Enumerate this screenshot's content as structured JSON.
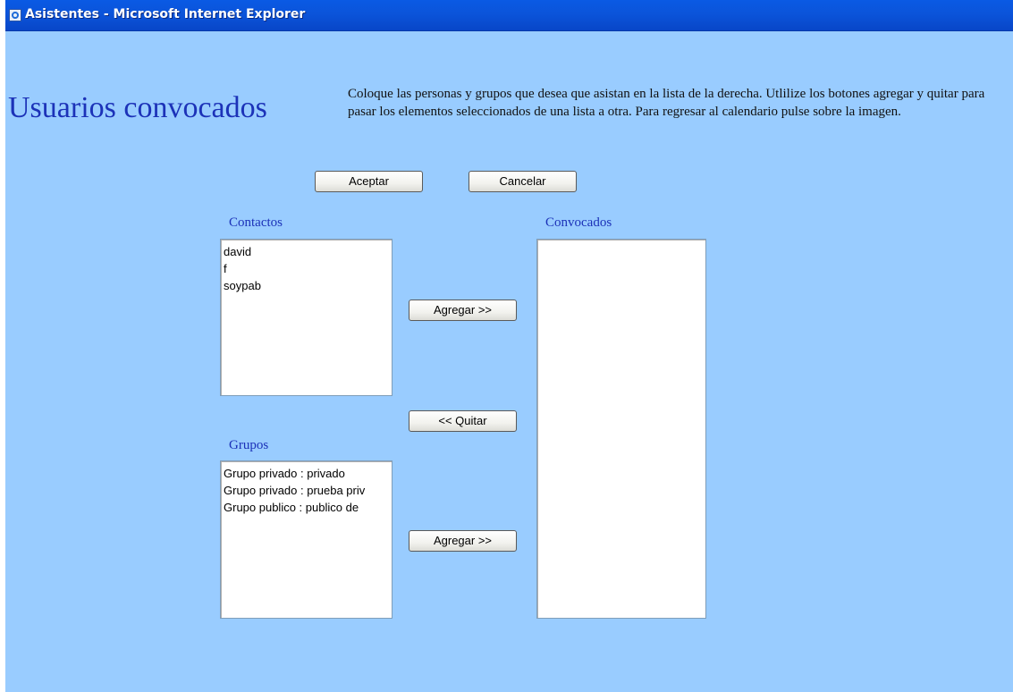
{
  "window": {
    "title": "Asistentes - Microsoft Internet Explorer"
  },
  "page": {
    "title": "Usuarios convocados",
    "instructions": "Coloque las personas y grupos que desea que asistan en la lista de la derecha. Utlilize los botones agregar y quitar para pasar los elementos seleccionados de una lista a otra. Para regresar al calendario pulse sobre la imagen."
  },
  "buttons": {
    "accept": "Aceptar",
    "cancel": "Cancelar",
    "add_contacts": "Agregar >>",
    "remove": "<< Quitar",
    "add_groups": "Agregar >>"
  },
  "contacts": {
    "label": "Contactos",
    "items": [
      "david",
      "f",
      "soypab"
    ]
  },
  "groups": {
    "label": "Grupos",
    "items": [
      "Grupo privado : privado",
      "Grupo privado : prueba priv",
      "Grupo publico : publico de"
    ]
  },
  "invited": {
    "label": "Convocados",
    "items": []
  }
}
